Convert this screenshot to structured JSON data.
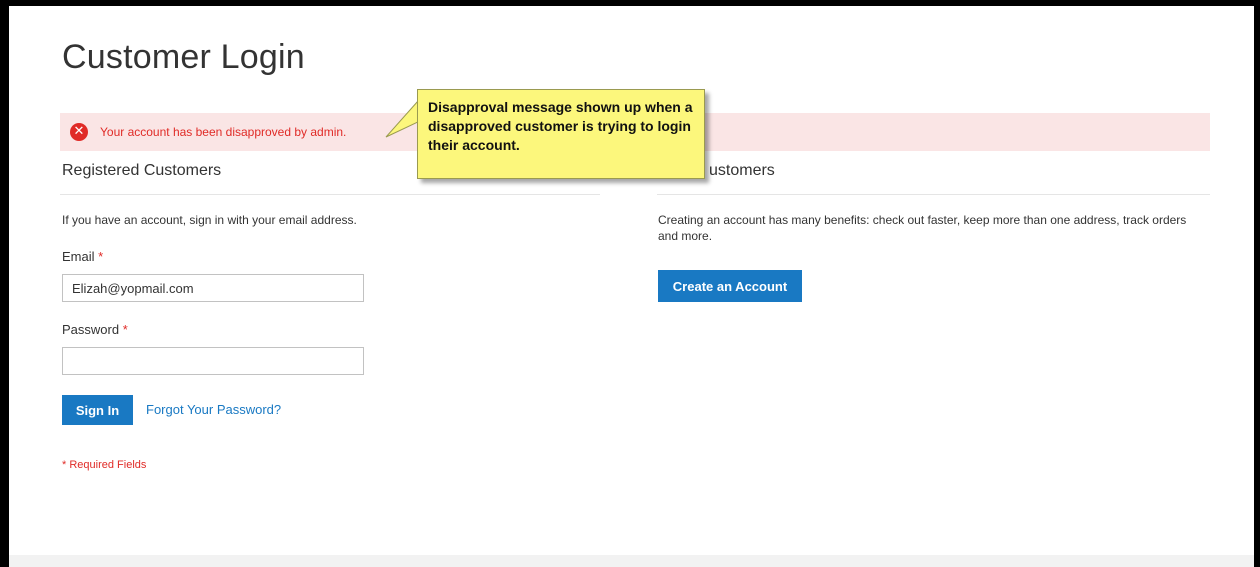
{
  "page": {
    "title": "Customer Login"
  },
  "message": {
    "icon": "error-x-icon",
    "text": "Your account has been disapproved by admin."
  },
  "registered": {
    "title": "Registered Customers",
    "intro": "If you have an account, sign in with your email address.",
    "email_label": "Email",
    "email_value": "Elizah@yopmail.com",
    "password_label": "Password",
    "password_value": "",
    "required_star": "*",
    "sign_in_label": "Sign In",
    "forgot_label": "Forgot Your Password?",
    "required_note": "* Required Fields"
  },
  "new_customers": {
    "title": "ustomers",
    "intro": "Creating an account has many benefits: check out faster, keep more than one address, track orders and more.",
    "create_label": "Create an Account"
  },
  "annotation": {
    "text": "Disapproval message shown up when a disapproved customer is trying to login their account."
  },
  "colors": {
    "accent": "#1979c3",
    "error": "#e02b27",
    "error_bg": "#fae5e5",
    "callout_bg": "#fcf77c"
  }
}
